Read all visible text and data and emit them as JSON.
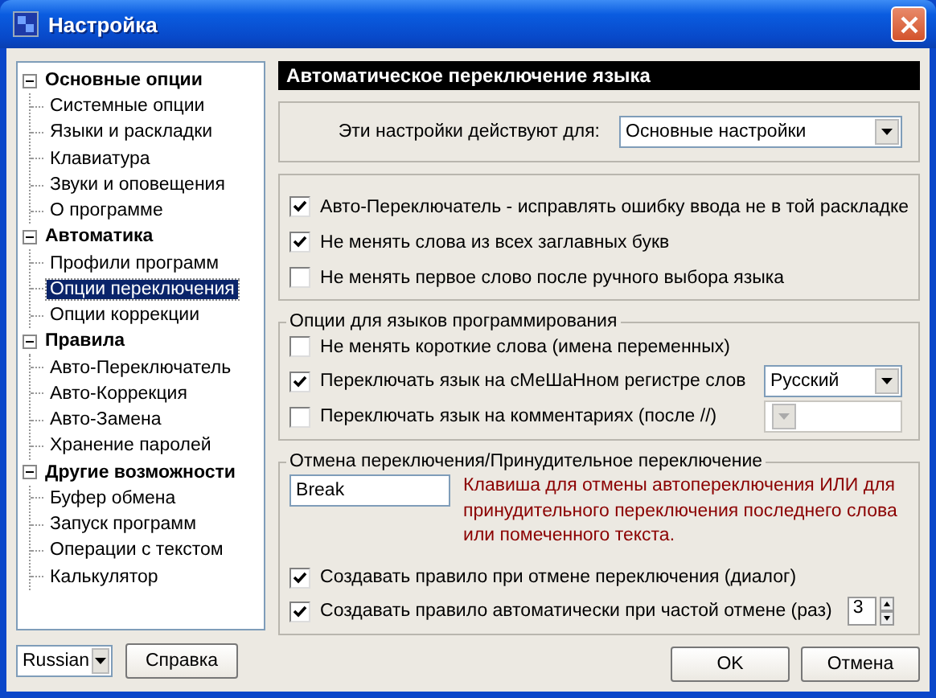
{
  "window": {
    "title": "Настройка"
  },
  "tree": [
    {
      "label": "Основные опции",
      "expanded": true,
      "selected": false,
      "children": [
        {
          "label": "Системные опции",
          "selected": false
        },
        {
          "label": "Языки и раскладки",
          "selected": false
        },
        {
          "label": "Клавиатура",
          "selected": false
        },
        {
          "label": "Звуки и оповещения",
          "selected": false
        },
        {
          "label": "О программе",
          "selected": false
        }
      ]
    },
    {
      "label": "Автоматика",
      "expanded": true,
      "selected": false,
      "children": [
        {
          "label": "Профили программ",
          "selected": false
        },
        {
          "label": "Опции переключения",
          "selected": true
        },
        {
          "label": "Опции коррекции",
          "selected": false
        }
      ]
    },
    {
      "label": "Правила",
      "expanded": true,
      "selected": false,
      "children": [
        {
          "label": "Авто-Переключатель",
          "selected": false
        },
        {
          "label": "Авто-Коррекция",
          "selected": false
        },
        {
          "label": "Авто-Замена",
          "selected": false
        },
        {
          "label": "Хранение паролей",
          "selected": false
        }
      ]
    },
    {
      "label": "Другие возможности",
      "expanded": true,
      "selected": false,
      "children": [
        {
          "label": "Буфер обмена",
          "selected": false
        },
        {
          "label": "Запуск программ",
          "selected": false
        },
        {
          "label": "Операции с текстом",
          "selected": false
        },
        {
          "label": "Калькулятор",
          "selected": false
        }
      ]
    }
  ],
  "language_select": {
    "value": "Russian"
  },
  "help_button": "Справка",
  "header": "Автоматическое переключение языка",
  "applies_to": {
    "label": "Эти настройки действуют для:",
    "value": "Основные настройки"
  },
  "options": [
    {
      "label": "Авто-Переключатель - исправлять ошибку ввода не в той раскладке",
      "checked": true
    },
    {
      "label": "Не менять слова из всех заглавных букв",
      "checked": true
    },
    {
      "label": "Не менять первое слово после ручного выбора языка",
      "checked": false
    }
  ],
  "programming_group": {
    "title": "Опции для языков программирования",
    "options": [
      {
        "kind": "checkbox",
        "label": "Не менять короткие слова (имена переменных)",
        "checked": false
      },
      {
        "kind": "checkbox-select",
        "label": "Переключать язык на сМеШаНном регистре слов",
        "checked": true,
        "select": {
          "value": "Русский",
          "disabled": false
        }
      },
      {
        "kind": "checkbox-select",
        "label": "Переключать язык на комментариях (после //)",
        "checked": false,
        "select": {
          "disabled": true
        }
      }
    ]
  },
  "undo_group": {
    "title": "Отмена переключения/Принудительное переключение",
    "hotkey": "Break",
    "hint": "Клавиша для отмены автопереключения ИЛИ для принудительного переключения последнего слова или помеченного текста.",
    "options": [
      {
        "kind": "checkbox",
        "label": "Создавать правило при отмене переключения (диалог)",
        "checked": true
      },
      {
        "kind": "checkbox-spin",
        "label": "Создавать правило автоматически при частой отмене (раз)",
        "checked": true,
        "value": "3"
      }
    ]
  },
  "buttons": [
    "OK",
    "Отмена"
  ]
}
